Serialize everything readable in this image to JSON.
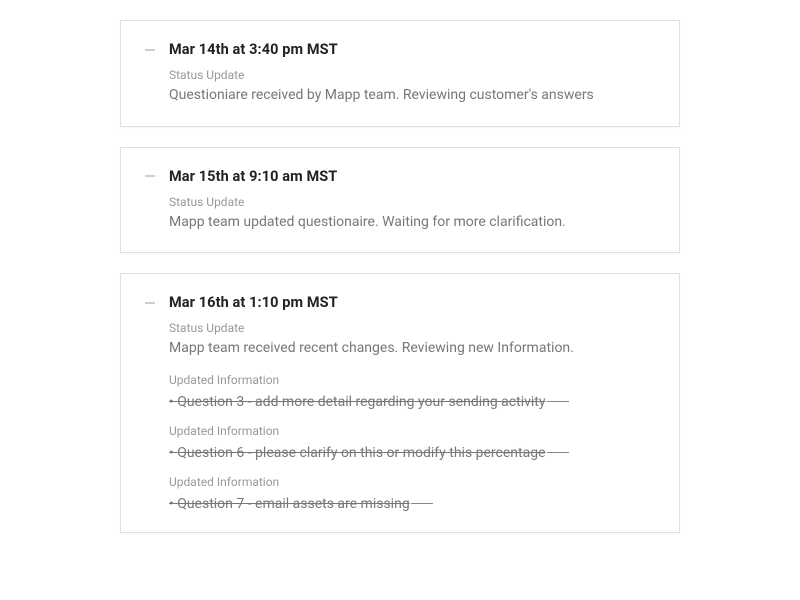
{
  "updates": [
    {
      "timestamp": "Mar 14th at 3:40 pm MST",
      "sections": [
        {
          "label": "Status Update",
          "body": "Questioniare received by Mapp team. Reviewing customer's answers",
          "strike": false
        }
      ]
    },
    {
      "timestamp": "Mar 15th at 9:10 am MST",
      "sections": [
        {
          "label": "Status Update",
          "body": "Mapp team updated questionaire. Waiting for more clarification.",
          "strike": false
        }
      ]
    },
    {
      "timestamp": "Mar 16th at 1:10 pm MST",
      "sections": [
        {
          "label": "Status Update",
          "body": "Mapp team received recent changes. Reviewing new Information.",
          "strike": false
        },
        {
          "label": "Updated Information",
          "body": "Question 3 - add more detail regarding your sending activity",
          "strike": true
        },
        {
          "label": "Updated Information",
          "body": "Question 6 - please clarify on this or modify this percentage",
          "strike": true
        },
        {
          "label": "Updated Information",
          "body": "Question 7 - email assets are missing",
          "strike": true
        }
      ]
    }
  ]
}
